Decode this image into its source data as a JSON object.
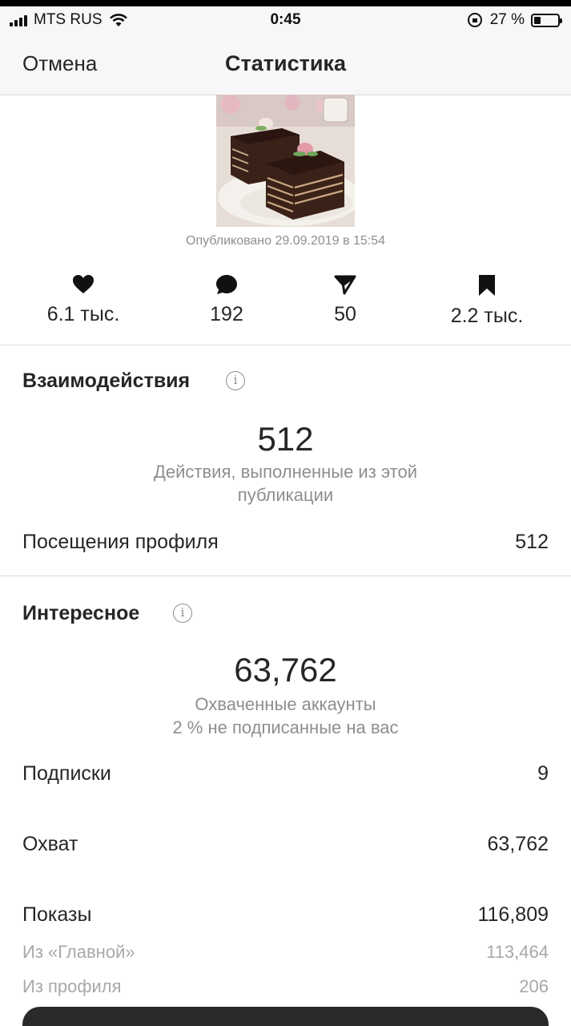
{
  "status_bar": {
    "carrier": "MTS RUS",
    "time": "0:45",
    "battery_text": "27 %",
    "battery_level": 0.27
  },
  "nav": {
    "cancel": "Отмена",
    "title": "Статистика"
  },
  "post": {
    "published": "Опубликовано 29.09.2019 в 15:54"
  },
  "counts": [
    {
      "icon": "heart-icon",
      "value": "6.1 тыс."
    },
    {
      "icon": "comment-icon",
      "value": "192"
    },
    {
      "icon": "share-icon",
      "value": "50"
    },
    {
      "icon": "bookmark-icon",
      "value": "2.2 тыс."
    }
  ],
  "interactions": {
    "title": "Взаимодействия",
    "total": "512",
    "caption_line1": "Действия, выполненные из этой",
    "caption_line2": "публикации",
    "rows": [
      {
        "label": "Посещения профиля",
        "value": "512"
      }
    ]
  },
  "discovery": {
    "title": "Интересное",
    "total": "63,762",
    "caption_line1": "Охваченные аккаунты",
    "caption_line2": "2 % не подписанные на вас",
    "rows": [
      {
        "label": "Подписки",
        "value": "9"
      },
      {
        "label": "Охват",
        "value": "63,762"
      },
      {
        "label": "Показы",
        "value": "116,809"
      }
    ],
    "sub_rows": [
      {
        "label": "Из «Главной»",
        "value": "113,464"
      },
      {
        "label": "Из профиля",
        "value": "206"
      }
    ]
  }
}
